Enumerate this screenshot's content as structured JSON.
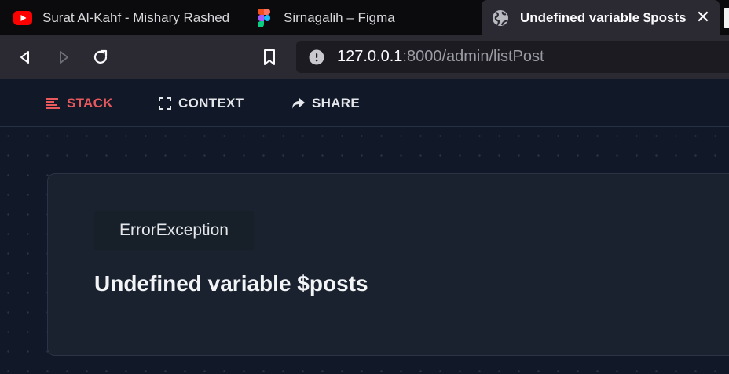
{
  "browser": {
    "tabs": [
      {
        "title": "Surat Al-Kahf - Mishary Rashed",
        "favicon": "youtube-icon",
        "active": false
      },
      {
        "title": "Sirnagalih – Figma",
        "favicon": "figma-icon",
        "active": false
      },
      {
        "title": "Undefined variable $posts",
        "favicon": "globe-icon",
        "active": true
      }
    ],
    "close_glyph": "✕",
    "url": {
      "host": "127.0.0.1",
      "rest": ":8000/admin/listPost"
    }
  },
  "ignition": {
    "tabs": [
      {
        "label": "STACK",
        "icon": "stack-icon",
        "active": true
      },
      {
        "label": "CONTEXT",
        "icon": "expand-icon",
        "active": false
      },
      {
        "label": "SHARE",
        "icon": "share-icon",
        "active": false
      }
    ],
    "exception_class": "ErrorException",
    "message": "Undefined variable $posts"
  },
  "colors": {
    "accent_red": "#e8595e",
    "page_bg": "#111827",
    "card_bg": "#1a2230",
    "browser_toolbar": "#2b2a33",
    "tabstrip": "#0b0b0d"
  }
}
